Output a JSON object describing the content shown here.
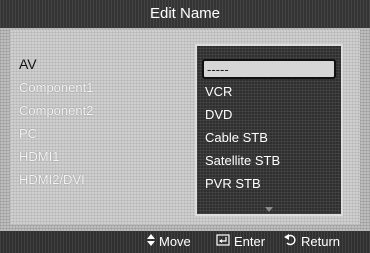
{
  "dialog": {
    "title": "Edit Name"
  },
  "sources": [
    {
      "label": "AV"
    },
    {
      "label": "Component1"
    },
    {
      "label": "Component2"
    },
    {
      "label": "PC"
    },
    {
      "label": "HDMI1"
    },
    {
      "label": "HDMI2/DVI"
    }
  ],
  "dropdown": {
    "options": [
      {
        "label": "-----",
        "selected": true
      },
      {
        "label": "VCR"
      },
      {
        "label": "DVD"
      },
      {
        "label": "Cable STB"
      },
      {
        "label": "Satellite STB"
      },
      {
        "label": "PVR STB"
      }
    ],
    "scroll_icon": "triangle-down-icon"
  },
  "footer": {
    "move_label": "Move",
    "enter_label": "Enter",
    "return_label": "Return",
    "move_icon": "up-down-arrows-icon",
    "enter_icon": "enter-key-icon",
    "return_icon": "return-arrow-icon"
  }
}
